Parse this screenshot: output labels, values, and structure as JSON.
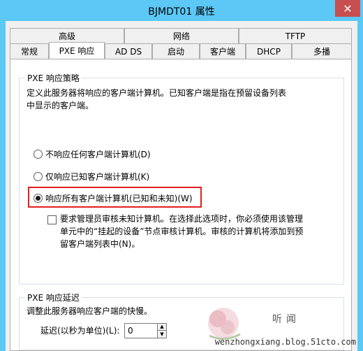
{
  "window": {
    "title": "BJMDT01 属性",
    "close_label": "✕"
  },
  "tabs": {
    "top_row": [
      "高级",
      "网络",
      "TFTP"
    ],
    "bottom_row": [
      "常规",
      "PXE 响应",
      "AD DS",
      "启动",
      "客户端",
      "DHCP",
      "多播"
    ],
    "active": "PXE 响应"
  },
  "policy": {
    "legend": "PXE 响应策略",
    "description_line1": "定义此服务器将响应的客户端计算机。已知客户端是指在预留设备列表",
    "description_line2": "中显示的客户端。",
    "options": [
      {
        "label": "不响应任何客户端计算机(D)",
        "selected": false
      },
      {
        "label": "仅响应已知客户端计算机(K)",
        "selected": false
      },
      {
        "label": "响应所有客户端计算机(已知和未知)(W)",
        "selected": true
      }
    ],
    "approval_text_line1": "要求管理员审核未知计算机。在选择此选项时，你必须使用该管理",
    "approval_text_line2": "单元中的“挂起的设备”节点审核计算机。审核的计算机将添加到预",
    "approval_text_line3": "留客户端列表中(N)。",
    "approval_checked": false
  },
  "delay": {
    "legend": "PXE 响应延迟",
    "description": "调整此服务器响应客户端的快慢。",
    "label": "延迟(以秒为单位)(L):",
    "value": "0"
  },
  "watermark": {
    "text": "wenzhongxiang.blog.51cto.com",
    "cn": "听闻"
  },
  "colors": {
    "titlebar": "#5bc8f5",
    "close": "#c74f4f",
    "highlight": "#e0201e"
  }
}
